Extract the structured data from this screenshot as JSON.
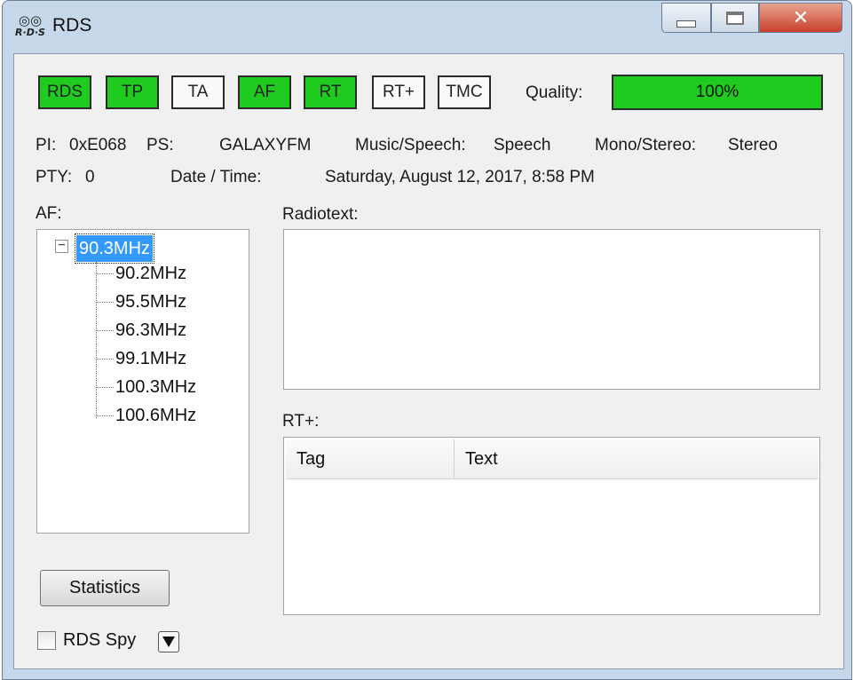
{
  "window": {
    "title": "RDS",
    "logo_text": "R·D·S",
    "controls": {
      "minimize": "minimize",
      "maximize": "maximize",
      "close": "✕"
    }
  },
  "indicators": [
    {
      "label": "RDS",
      "active": true
    },
    {
      "label": "TP",
      "active": true
    },
    {
      "label": "TA",
      "active": false
    },
    {
      "label": "AF",
      "active": true
    },
    {
      "label": "RT",
      "active": true
    },
    {
      "label": "RT+",
      "active": false
    },
    {
      "label": "TMC",
      "active": false
    }
  ],
  "quality": {
    "label": "Quality:",
    "value_text": "100%",
    "value": 1.0,
    "color": "#1ecb1e"
  },
  "info": {
    "pi_label": "PI:",
    "pi_value": "0xE068",
    "ps_label": "PS:",
    "ps_value": "GALAXYFM",
    "music_label": "Music/Speech:",
    "music_value": "Speech",
    "mono_label": "Mono/Stereo:",
    "mono_value": "Stereo",
    "pty_label": "PTY:",
    "pty_value": "0",
    "datetime_label": "Date / Time:",
    "datetime_value": "Saturday, August 12, 2017, 8:58 PM"
  },
  "af": {
    "label": "AF:",
    "root": "90.3MHz",
    "items": [
      "90.2MHz",
      "95.5MHz",
      "96.3MHz",
      "99.1MHz",
      "100.3MHz",
      "100.6MHz"
    ]
  },
  "radiotext": {
    "label": "Radiotext:",
    "value": ""
  },
  "rtplus": {
    "label": "RT+:",
    "columns": [
      "Tag",
      "Text"
    ],
    "rows": []
  },
  "buttons": {
    "statistics": "Statistics"
  },
  "rds_spy": {
    "label": "RDS Spy",
    "checked": false
  },
  "colors": {
    "active": "#1ecb1e",
    "selection": "#3399ff",
    "frame": "#c6d7ea"
  }
}
